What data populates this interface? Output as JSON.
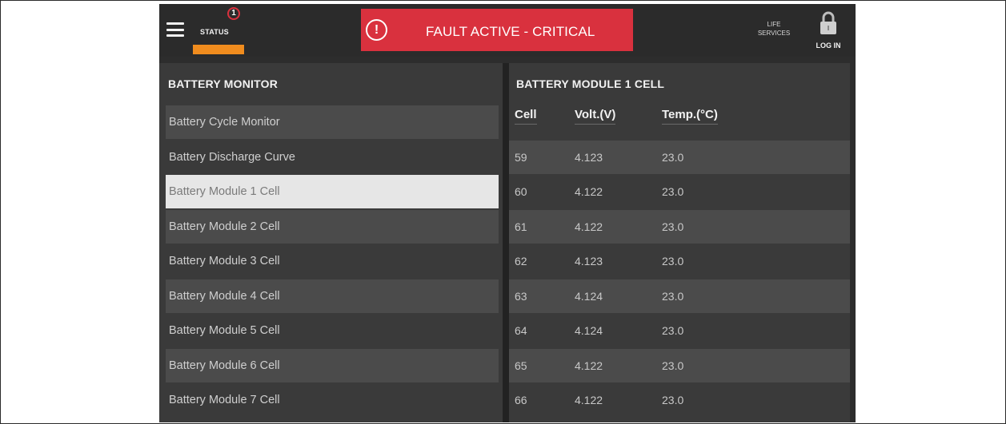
{
  "header": {
    "status_label": "STATUS",
    "status_badge_count": "1",
    "fault_text": "FAULT ACTIVE - CRITICAL",
    "fault_icon_glyph": "!",
    "life_services_line1": "LIFE",
    "life_services_line2": "SERVICES",
    "login_label": "LOG IN"
  },
  "colors": {
    "fault_red": "#d9313e",
    "status_orange": "#f08c1e",
    "selected_bg": "#e6e6e6"
  },
  "icons": {
    "menu": "hamburger-menu-icon",
    "fault": "exclamation-circle-icon",
    "lock": "padlock-icon"
  },
  "left_panel": {
    "title": "BATTERY MONITOR",
    "items": [
      {
        "label": "Battery Cycle Monitor"
      },
      {
        "label": "Battery Discharge Curve"
      },
      {
        "label": "Battery Module 1 Cell",
        "selected": true
      },
      {
        "label": "Battery Module 2 Cell"
      },
      {
        "label": "Battery Module 3 Cell"
      },
      {
        "label": "Battery Module 4 Cell"
      },
      {
        "label": "Battery Module 5 Cell"
      },
      {
        "label": "Battery Module 6 Cell"
      },
      {
        "label": "Battery Module 7 Cell"
      }
    ]
  },
  "right_panel": {
    "title": "BATTERY MODULE 1 CELL",
    "columns": [
      "Cell",
      "Volt.(V)",
      "Temp.(°C)"
    ],
    "rows": [
      [
        "59",
        "4.123",
        "23.0"
      ],
      [
        "60",
        "4.122",
        "23.0"
      ],
      [
        "61",
        "4.122",
        "23.0"
      ],
      [
        "62",
        "4.123",
        "23.0"
      ],
      [
        "63",
        "4.124",
        "23.0"
      ],
      [
        "64",
        "4.124",
        "23.0"
      ],
      [
        "65",
        "4.122",
        "23.0"
      ],
      [
        "66",
        "4.122",
        "23.0"
      ]
    ]
  }
}
